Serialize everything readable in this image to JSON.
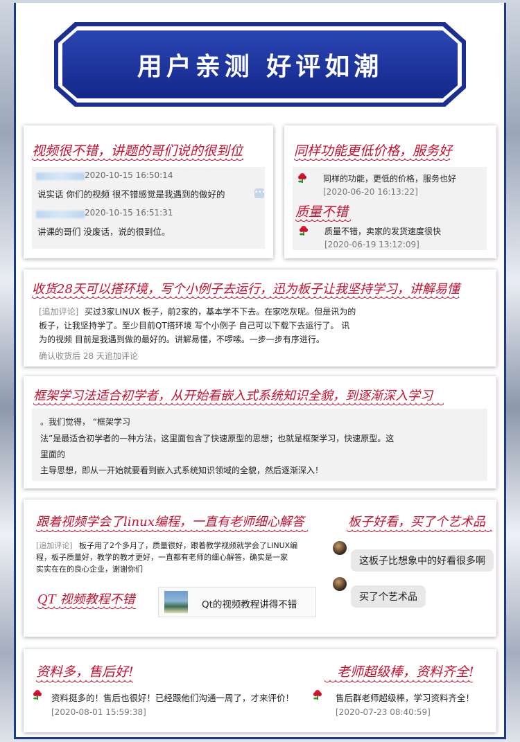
{
  "banner": {
    "title": "用户亲测 好评如潮"
  },
  "colors": {
    "brand_blue": "#1a2f8f",
    "accent_red": "#c8102e"
  },
  "card1": {
    "heading": "视频很不错，讲题的哥们说的很到位",
    "comments": [
      {
        "time": "2020-10-15 16:50:14",
        "text": "说实话 你们的视频 很不错感觉是我遇到的做好的"
      },
      {
        "time": "2020-10-15 16:51:31",
        "text": "讲课的哥们 没废话，说的很到位。"
      }
    ],
    "more_icon": "•••"
  },
  "card2": {
    "heading1": "同样功能更低价格，服务好",
    "review1": {
      "text": "同样的功能，更低的价格，服务也好",
      "time": "[2020-06-20 16:13:22]"
    },
    "heading2": "质量不错",
    "review2": {
      "text": "质量不错，卖家的发货速度很快",
      "time": "[2020-06-19 13:12:09]"
    }
  },
  "card3": {
    "heading": "收货28天可以搭环境，写个小例子去运行，迅为板子让我坚持学习，讲解易懂",
    "tag": "[追加评论]",
    "lines": [
      "买过3家LINUX 板子，前2家的，基本学不下去。在家吃灰呢。但是讯为的",
      "板子，让我坚持学了。至少目前QT搭环境 写个小例子 自己可以下载下去运行了。 讯",
      "为的视频 目前是我遇到做的最好的。讲解易懂，不啰嗦。一步一步有序进行。"
    ],
    "footer": "确认收货后 28 天追加评论"
  },
  "card4": {
    "heading": "框架学习法适合初学者，从开始看嵌入式系统知识全貌，到逐渐深入学习",
    "lines": [
      "。我们觉得，  “框架学习",
      "法”是最适合初学者的一种方法，这里面包含了快速原型的思想；也就是框架学习，快速原型。这",
      "里面的",
      "主导思想，即从一开始就要看到嵌入式系统知识领域的全貌，然后逐渐深入！"
    ]
  },
  "card5": {
    "heading_left": "跟着视频学会了linux编程，一直有老师细心解答",
    "tag": "[追加评论]",
    "lines": [
      "板子用了2个多月了，质量很好，跟着教学视频就学会了LINUX编",
      "程，板子质量好，教学的教才更好，一直都有老师的细心解答，确实是一家",
      "实实在在的良心企业，谢谢你们"
    ],
    "heading_qt": "QT 视频教程不错",
    "qt_text": "Qt的视频教程讲得不错",
    "heading_right": "板子好看，买了个艺术品",
    "bubbles": [
      "这板子比想象中的好看很多啊",
      "买了个艺术品"
    ]
  },
  "card6": {
    "heading_left": "资料多，售后好!",
    "review_left": {
      "text": "资料挺多的！售后也很好！已经跟他们沟通一周了，才来评价！",
      "time": "[2020-08-01 15:59:38]"
    },
    "heading_right": "老师超级棒，资料齐全!",
    "review_right": {
      "text": "售后群老师超级棒，学习资料齐全！",
      "time": "[2020-07-23 08:40:59]"
    }
  }
}
